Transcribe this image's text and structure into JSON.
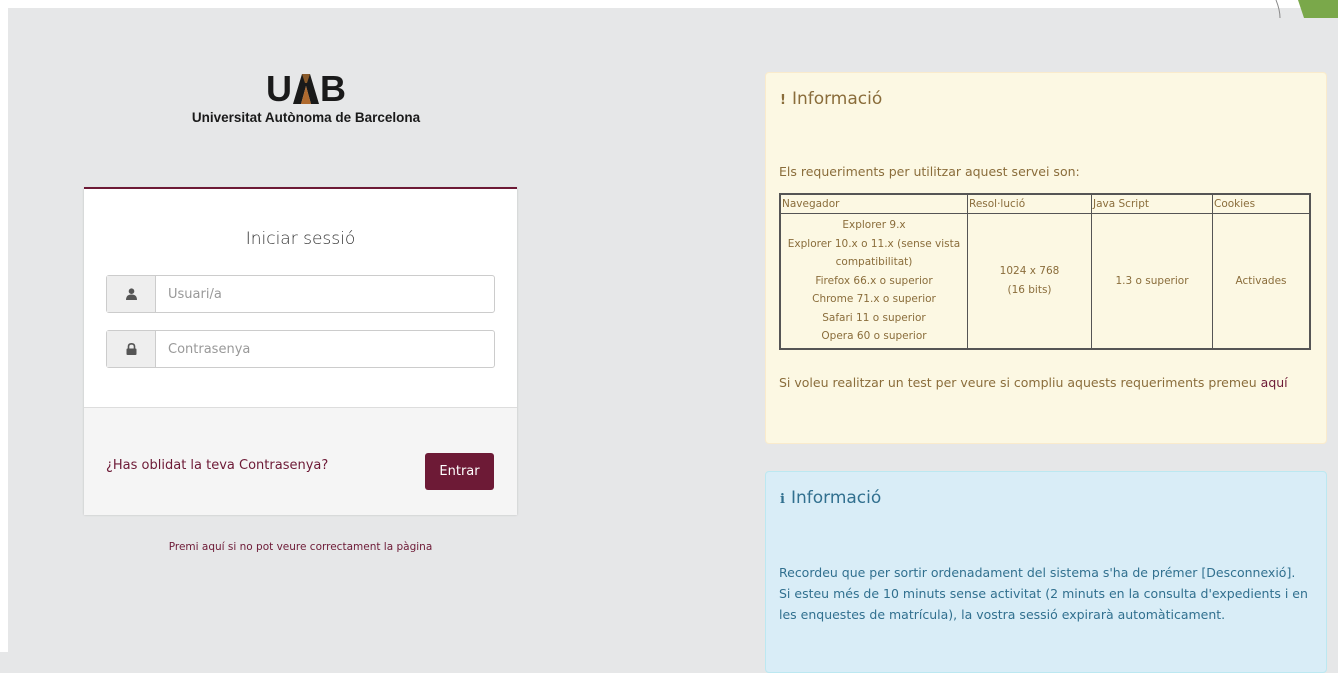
{
  "logo": {
    "mark_left": "U",
    "mark_right": "B",
    "subtitle": "Universitat Autònoma de Barcelona"
  },
  "login": {
    "title": "Iniciar sessió",
    "user_placeholder": "Usuari/a",
    "password_placeholder": "Contrasenya",
    "forgot_label": "¿Has oblidat la teva Contrasenya?",
    "submit_label": "Entrar",
    "help_link": "Premi aquí si no pot veure correctament la pàgina"
  },
  "info_requirements": {
    "icon": "!",
    "title": "Informació",
    "intro": "Els requeriments per utilitzar aquest servei son:",
    "table": {
      "headers": [
        "Navegador",
        "Resol·lució",
        "Java Script",
        "Cookies"
      ],
      "browsers": [
        "Explorer 9.x",
        "Explorer 10.x o 11.x (sense vista compatibilitat)",
        "Firefox 66.x o superior",
        "Chrome 71.x o superior",
        "Safari 11 o superior",
        "Opera 60 o superior"
      ],
      "resolution_line1": "1024 x 768",
      "resolution_line2": "(16 bits)",
      "javascript": "1.3 o superior",
      "cookies": "Activades"
    },
    "test_text": "Si voleu realitzar un test per veure si compliu aquests requeriments premeu",
    "test_link": "aquí"
  },
  "info_logout": {
    "icon": "i",
    "title": "Informació",
    "line1": "Recordeu que per sortir ordenadament del sistema s'ha de prémer [Desconnexió].",
    "line2": "Si esteu més de 10 minuts sense activitat (2 minuts en la consulta d'expedients i en les enquestes de matrícula), la vostra sessió expirarà automàticament."
  },
  "colors": {
    "brand": "#6d1a36",
    "warning_bg": "#fcf8e3",
    "warning_text": "#8a6d3b",
    "info_bg": "#d9edf7",
    "info_text": "#31708f",
    "page_bg": "#e6e7e8"
  }
}
